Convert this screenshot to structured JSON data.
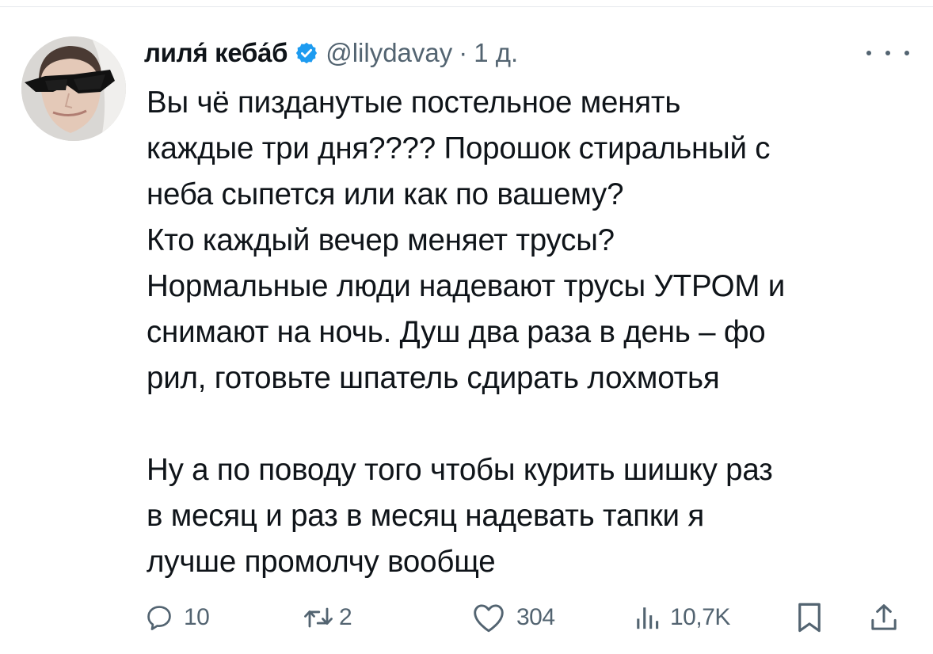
{
  "author": {
    "display_name": "лиля́ кеба́б",
    "handle": "@lilydavay",
    "separator": "·",
    "time": "1 д."
  },
  "tweet": {
    "paragraphs": [
      [
        "Вы чё пизданутые постельное менять",
        "каждые три дня???? Порошок стиральный с",
        "неба сыпется или как по вашему?",
        "Кто каждый вечер меняет трусы?",
        "Нормальные люди надевают трусы УТРОМ и",
        "снимают на ночь. Душ два раза в день – фо",
        "рил, готовьте шпатель сдирать лохмотья"
      ],
      [
        "Ну а по поводу того чтобы курить шишку раз",
        "в месяц и раз в месяц надевать тапки я",
        "лучше промолчу вообще"
      ]
    ]
  },
  "actions": {
    "replies": "10",
    "reposts": "2",
    "likes": "304",
    "views": "10,7K"
  },
  "icons": {
    "verified": "verified-badge-icon",
    "more": "more-icon",
    "reply": "reply-icon",
    "repost": "repost-icon",
    "like": "like-icon",
    "views": "views-icon",
    "bookmark": "bookmark-icon",
    "share": "share-icon"
  },
  "colors": {
    "text": "#0f1419",
    "secondary": "#536471",
    "verified": "#1d9bf0"
  }
}
